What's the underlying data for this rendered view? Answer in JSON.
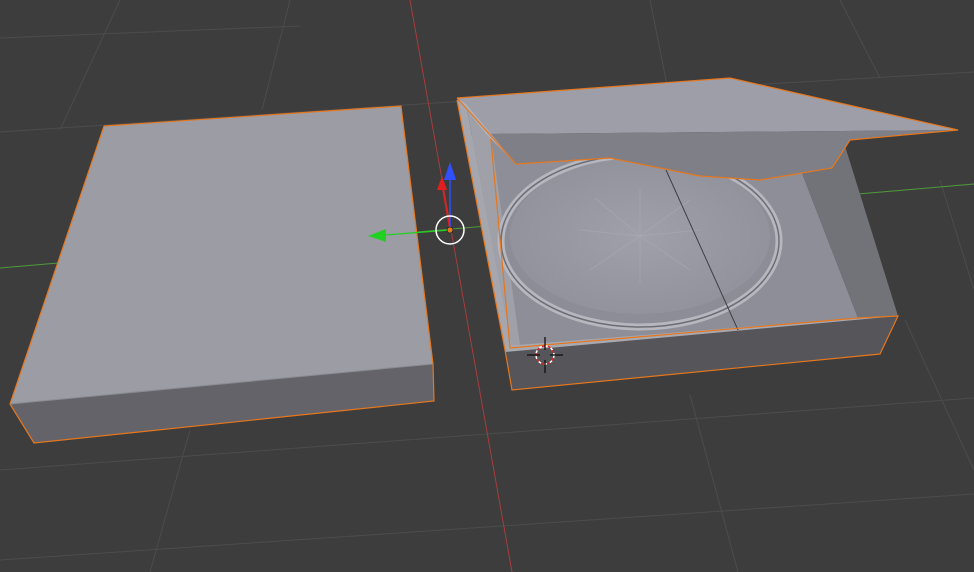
{
  "viewport": {
    "background_color": "#3d3d3d",
    "grid_color": "#4c4c4c",
    "x_axis_color": "#a83c3c",
    "y_axis_color": "#4f9a3c",
    "selection_outline_color": "#e5771e"
  },
  "scene": {
    "objects": [
      {
        "name": "lid-panel",
        "selected": true
      },
      {
        "name": "case-tray",
        "selected": true
      },
      {
        "name": "tray-flap",
        "selected": true
      },
      {
        "name": "disc",
        "selected": false
      }
    ]
  },
  "gizmo": {
    "type": "translate",
    "x_handle_color": "#e02020",
    "y_handle_color": "#22d022",
    "z_handle_color": "#3050ff",
    "pivot_color": "#e5771e"
  },
  "cursor_3d": {
    "icon": "crosshair-icon"
  }
}
